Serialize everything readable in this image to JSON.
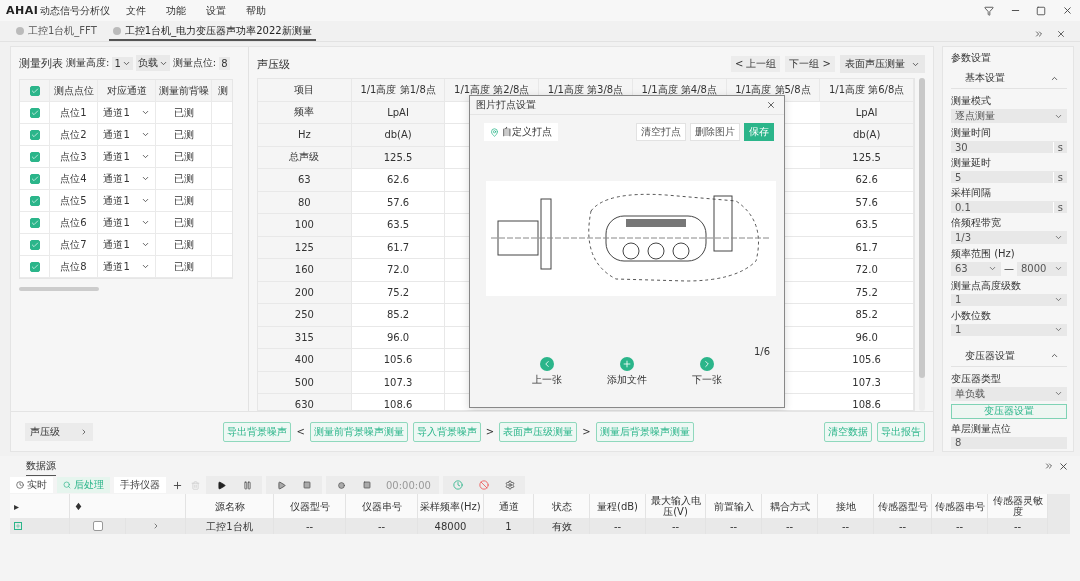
{
  "app": {
    "logo": "AHAI",
    "title": "动态信号分析仪",
    "menu": [
      "文件",
      "功能",
      "设置",
      "帮助"
    ]
  },
  "doc_tabs": [
    {
      "label": "工控1台机_FFT",
      "selected": false
    },
    {
      "label": "工控1台机_电力变压器声功率2022新测量",
      "selected": true
    }
  ],
  "measure_list": {
    "title": "测量列表",
    "height_label": "测量高度:",
    "height_value": "1",
    "load_value": "负载",
    "points_label": "测量点位:",
    "points_value": "8",
    "header_checked": true,
    "columns": [
      "测点点位",
      "对应通道",
      "测量前背噪",
      "测"
    ],
    "rows": [
      {
        "checked": true,
        "point": "点位1",
        "channel": "通道1",
        "status": "已测"
      },
      {
        "checked": true,
        "point": "点位2",
        "channel": "通道1",
        "status": "已测"
      },
      {
        "checked": true,
        "point": "点位3",
        "channel": "通道1",
        "status": "已测"
      },
      {
        "checked": true,
        "point": "点位4",
        "channel": "通道1",
        "status": "已测"
      },
      {
        "checked": true,
        "point": "点位5",
        "channel": "通道1",
        "status": "已测"
      },
      {
        "checked": true,
        "point": "点位6",
        "channel": "通道1",
        "status": "已测"
      },
      {
        "checked": true,
        "point": "点位7",
        "channel": "通道1",
        "status": "已测"
      },
      {
        "checked": true,
        "point": "点位8",
        "channel": "通道1",
        "status": "已测"
      }
    ]
  },
  "spl": {
    "title": "声压级",
    "prev": "< 上一组",
    "next": "下一组 >",
    "mode": "表面声压测量",
    "columns": [
      "项目",
      "1/1高度 第1/8点",
      "1/1高度 第2/8点",
      "1/1高度 第3/8点",
      "1/1高度 第4/8点",
      "1/1高度 第5/8点",
      "1/1高度 第6/8点"
    ],
    "rows": [
      {
        "kind": "head",
        "item": "频率",
        "point_1": "LpAI",
        "point_6": "LpAI"
      },
      {
        "kind": "head",
        "item": "Hz",
        "point_1": "db(A)",
        "point_6": "db(A)"
      },
      {
        "kind": "head",
        "item": "总声级",
        "point_1": "125.5",
        "point_6": "125.5"
      },
      {
        "kind": "value",
        "item": "63",
        "point_1": "62.6",
        "point_6": "62.6"
      },
      {
        "kind": "value",
        "item": "80",
        "point_1": "57.6",
        "point_6": "57.6"
      },
      {
        "kind": "value",
        "item": "100",
        "point_1": "63.5",
        "point_6": "63.5"
      },
      {
        "kind": "value",
        "item": "125",
        "point_1": "61.7",
        "point_6": "61.7"
      },
      {
        "kind": "value",
        "item": "160",
        "point_1": "72.0",
        "point_6": "72.0"
      },
      {
        "kind": "value",
        "item": "200",
        "point_1": "75.2",
        "point_6": "75.2"
      },
      {
        "kind": "value",
        "item": "250",
        "point_1": "85.2",
        "point_6": "85.2"
      },
      {
        "kind": "value",
        "item": "315",
        "point_1": "96.0",
        "point_6": "96.0"
      },
      {
        "kind": "value",
        "item": "400",
        "point_1": "105.6",
        "point_6": "105.6"
      },
      {
        "kind": "value",
        "item": "500",
        "point_1": "107.3",
        "point_6": "107.3"
      },
      {
        "kind": "value",
        "item": "630",
        "point_1": "108.6",
        "point_6": "108.6"
      }
    ]
  },
  "action_bar": {
    "view_select": "声压级",
    "steps": [
      {
        "kind": "button",
        "label": "导出背景噪声"
      },
      {
        "kind": "arrow",
        "label": "<"
      },
      {
        "kind": "button",
        "label": "测量前背景噪声测量"
      },
      {
        "kind": "button",
        "label": "导入背景噪声"
      },
      {
        "kind": "arrow",
        "label": ">"
      },
      {
        "kind": "button",
        "label": "表面声压级测量"
      },
      {
        "kind": "arrow",
        "label": ">"
      },
      {
        "kind": "button",
        "label": "测量后背景噪声测量"
      }
    ],
    "right_buttons": [
      "清空数据",
      "导出报告"
    ]
  },
  "image_dialog": {
    "title": "图片打点设置",
    "custom_point": "自定义打点",
    "actions": [
      {
        "label": "清空打点",
        "primary": false
      },
      {
        "label": "删除图片",
        "primary": false
      },
      {
        "label": "保存",
        "primary": true
      }
    ],
    "page": "1/6",
    "nav": [
      {
        "kind": "prev",
        "label": "上一张"
      },
      {
        "kind": "add",
        "label": "添加文件"
      },
      {
        "kind": "next",
        "label": "下一张"
      }
    ]
  },
  "params": {
    "title": "参数设置",
    "sections": [
      {
        "title": "基本设置",
        "expanded": true,
        "fields": [
          {
            "kind": "select",
            "label": "测量模式",
            "value": "逐点测量"
          },
          {
            "kind": "unit",
            "label": "测量时间",
            "value": "30",
            "unit": "s"
          },
          {
            "kind": "unit",
            "label": "测量延时",
            "value": "5",
            "unit": "s"
          },
          {
            "kind": "unit",
            "label": "采样间隔",
            "value": "0.1",
            "unit": "s"
          },
          {
            "kind": "select",
            "label": "倍频程带宽",
            "value": "1/3"
          },
          {
            "kind": "range",
            "label": "频率范围 (Hz)",
            "from": "63",
            "sep": "—",
            "to": "8000"
          },
          {
            "kind": "select",
            "label": "测量点高度级数",
            "value": "1"
          },
          {
            "kind": "select",
            "label": "小数位数",
            "value": "1"
          }
        ]
      },
      {
        "title": "变压器设置",
        "expanded": true,
        "fields": [
          {
            "kind": "select",
            "label": "变压器类型",
            "value": "单负载"
          },
          {
            "kind": "button",
            "label": "变压器设置"
          },
          {
            "kind": "text",
            "label": "单层测量点位",
            "value": "8"
          }
        ]
      }
    ]
  },
  "data_source": {
    "tab": "数据源",
    "modes": [
      {
        "label": "实时",
        "selected": false
      },
      {
        "label": "后处理",
        "selected": true
      },
      {
        "label": "手持仪器",
        "selected": false
      }
    ],
    "time": "00:00:00",
    "lead_columns": [
      "▸",
      "♦"
    ],
    "columns": [
      "源名称",
      "仪器型号",
      "仪器串号",
      "采样频率(Hz)",
      "通道",
      "状态",
      "量程(dB)",
      "最大输入电压(V)",
      "前置输入",
      "耦合方式",
      "接地",
      "传感器型号",
      "传感器串号",
      "传感器灵敏度"
    ],
    "rows": [
      {
        "checked": false,
        "cells": [
          "工控1台机",
          "--",
          "--",
          "48000",
          "1",
          "有效",
          "--",
          "--",
          "--",
          "--",
          "--",
          "--",
          "--",
          "--"
        ]
      }
    ]
  }
}
